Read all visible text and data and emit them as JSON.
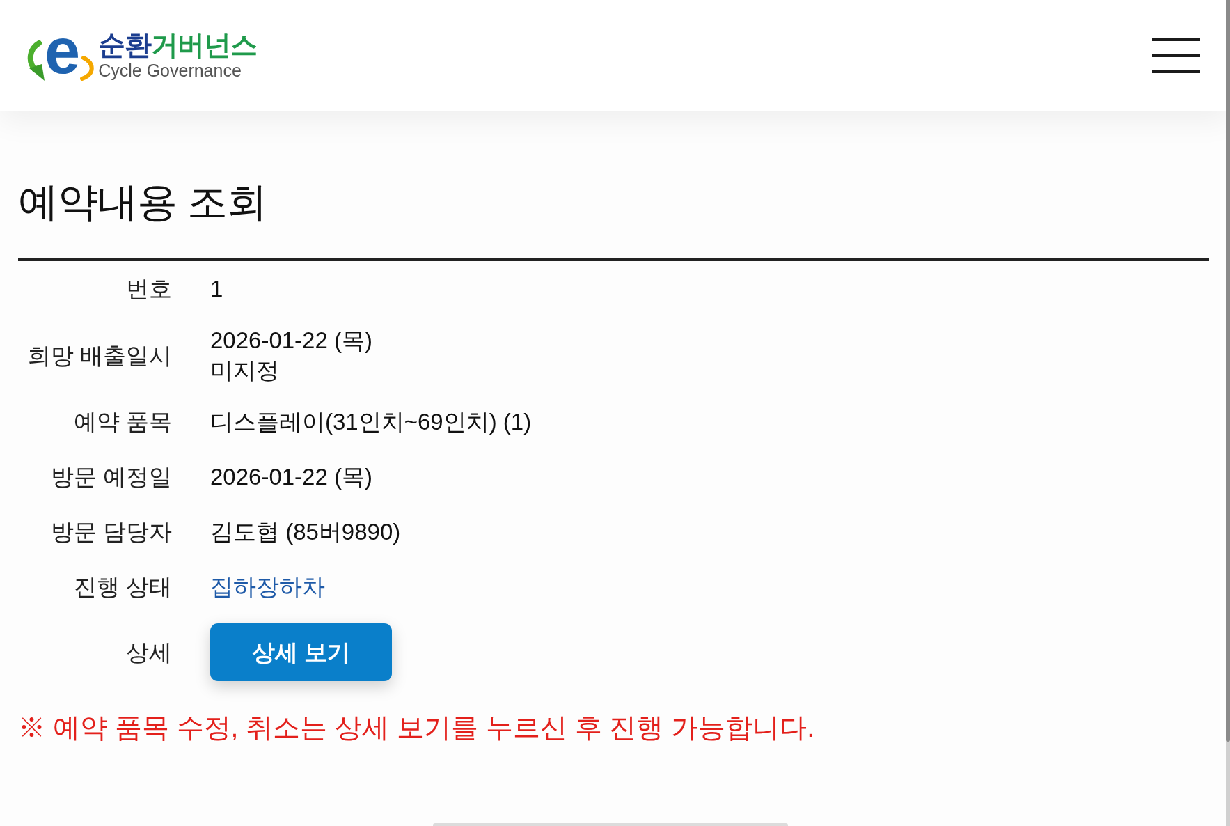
{
  "header": {
    "logo": {
      "mark": "e",
      "title_parts": [
        {
          "text": "순환",
          "color": "#1b3d8f"
        },
        {
          "text": "거버넌스",
          "color": "#1f9a4b"
        }
      ],
      "subtitle": "Cycle Governance"
    }
  },
  "page_title": "예약내용 조회",
  "details": [
    {
      "kind": "text",
      "label": "번호",
      "values": [
        "1"
      ]
    },
    {
      "kind": "text",
      "label": "희망 배출일시",
      "values": [
        "2026-01-22 (목)",
        "미지정"
      ]
    },
    {
      "kind": "text",
      "label": "예약 품목",
      "values": [
        "디스플레이(31인치~69인치) (1)"
      ]
    },
    {
      "kind": "text",
      "label": "방문 예정일",
      "values": [
        "2026-01-22 (목)"
      ]
    },
    {
      "kind": "text",
      "label": "방문 담당자",
      "values": [
        "김도협 (85버9890)"
      ]
    },
    {
      "kind": "status",
      "label": "진행 상태",
      "values": [
        "집하장하차"
      ]
    },
    {
      "kind": "button",
      "label": "상세",
      "values": [
        "상세 보기"
      ]
    }
  ],
  "notice": "※ 예약 품목 수정, 취소는 상세 보기를 누르신 후 진행 가능합니다."
}
